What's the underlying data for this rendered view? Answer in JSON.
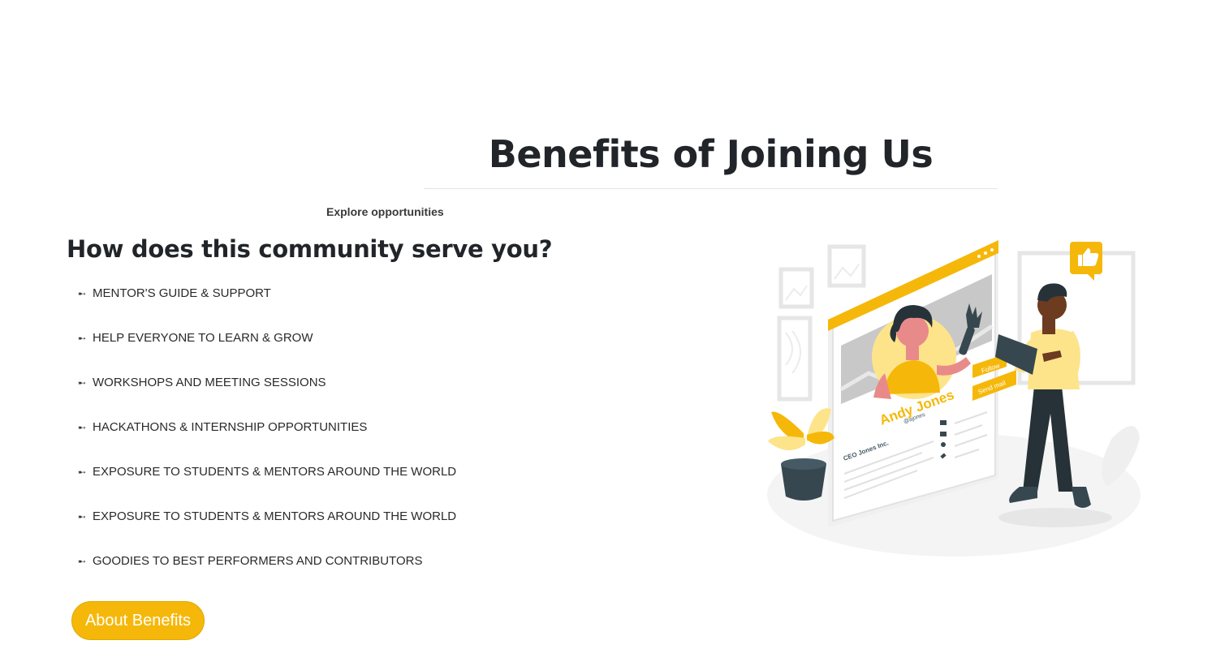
{
  "section": {
    "title": "Benefits of Joining Us",
    "eyebrow": "Explore opportunities",
    "heading": "How does this community serve you?"
  },
  "benefits": [
    {
      "bullet": "➸",
      "label": "MENTOR'S GUIDE & SUPPORT"
    },
    {
      "bullet": "➸",
      "label": "HELP EVERYONE TO LEARN & GROW"
    },
    {
      "bullet": "➸",
      "label": "WORKSHOPS AND MEETING SESSIONS"
    },
    {
      "bullet": "➸",
      "label": "HACKATHONS & INTERNSHIP OPPORTUNITIES"
    },
    {
      "bullet": "➸",
      "label": "EXPOSURE TO STUDENTS & MENTORS AROUND THE WORLD"
    },
    {
      "bullet": "➸",
      "label": "EXPOSURE TO STUDENTS & MENTORS AROUND THE WORLD"
    },
    {
      "bullet": "➸",
      "label": "GOODIES TO BEST PERFORMERS AND CONTRIBUTORS"
    }
  ],
  "cta": {
    "label": "About Benefits"
  },
  "illustration": {
    "profile_name": "Andy Jones",
    "profile_handle": "@ajones",
    "profile_company": "CEO Jones Inc.",
    "follow_label": "Follow",
    "send_mail_label": "Send mail"
  },
  "colors": {
    "accent": "#f5b80a",
    "text": "#212529",
    "divider": "#e3e3e3"
  }
}
